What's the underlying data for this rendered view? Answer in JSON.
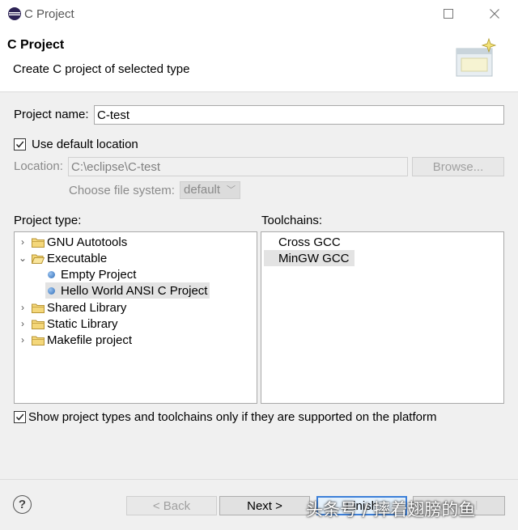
{
  "window": {
    "title": "C Project",
    "minimize": "□",
    "close": "✕"
  },
  "header": {
    "title": "C Project",
    "description": "Create C project of selected type"
  },
  "form": {
    "project_name_label": "Project name:",
    "project_name_value": "C-test",
    "use_default_location_label": "Use default location",
    "use_default_location_checked": true,
    "location_label": "Location:",
    "location_value": "C:\\eclipse\\C-test",
    "browse_label": "Browse...",
    "file_system_label": "Choose file system:",
    "file_system_value": "default"
  },
  "project_type": {
    "label": "Project type:",
    "items": [
      {
        "label": "GNU Autotools",
        "expanded": false,
        "kind": "folder"
      },
      {
        "label": "Executable",
        "expanded": true,
        "kind": "folder"
      },
      {
        "label": "Empty Project",
        "kind": "leaf"
      },
      {
        "label": "Hello World ANSI C Project",
        "kind": "leaf",
        "selected": true
      },
      {
        "label": "Shared Library",
        "expanded": false,
        "kind": "folder"
      },
      {
        "label": "Static Library",
        "expanded": false,
        "kind": "folder"
      },
      {
        "label": "Makefile project",
        "expanded": false,
        "kind": "folder"
      }
    ]
  },
  "toolchains": {
    "label": "Toolchains:",
    "items": [
      {
        "label": "Cross GCC"
      },
      {
        "label": "MinGW GCC",
        "selected": true
      }
    ]
  },
  "filter": {
    "label": "Show project types and toolchains only if they are supported on the platform",
    "checked": true
  },
  "footer": {
    "help": "?",
    "back_label": "< Back",
    "next_label": "Next >",
    "finish_label": "Finish",
    "cancel_label": "Cancel"
  },
  "watermark": "头条号 / 摔着翅膀的鱼",
  "colors": {
    "selection": "#e3e3e3",
    "default_button_border": "#3c7fd8"
  }
}
